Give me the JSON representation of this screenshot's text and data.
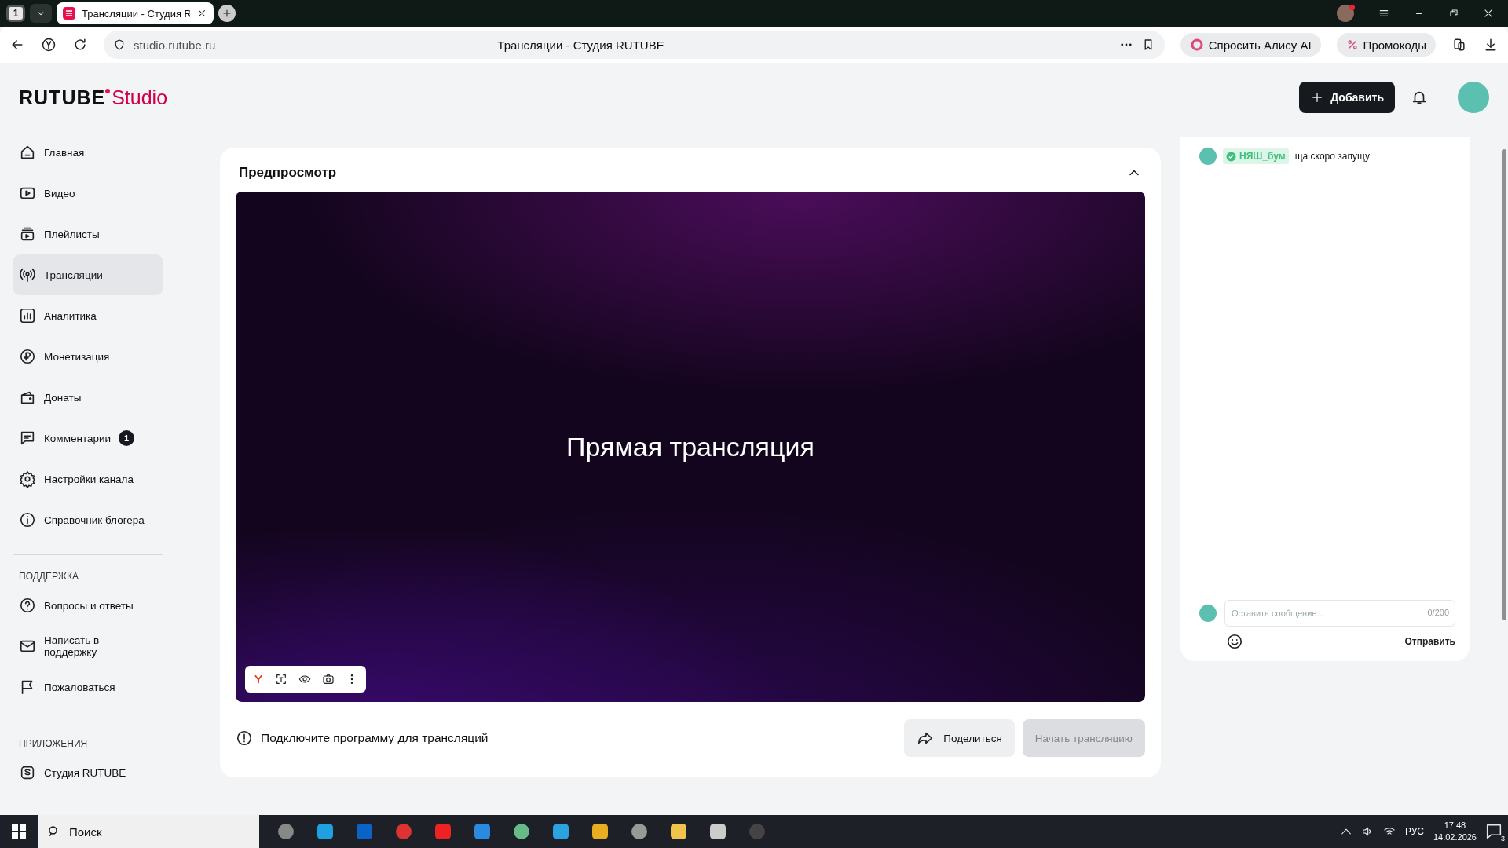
{
  "browser": {
    "tab_count": "1",
    "tabs": [
      {
        "title": "Трансляции - Студия R",
        "selected": true
      }
    ],
    "url": "studio.rutube.ru",
    "page_title": "Трансляции - Студия RUTUBE",
    "buttons": [
      "Спросить Алису AI",
      "Промокоды"
    ]
  },
  "header": {
    "logo": "RUTUBE",
    "logo_suffix": "Studio",
    "add_button": "Добавить"
  },
  "sidebar": {
    "items": [
      {
        "label": "Главная",
        "selected": false
      },
      {
        "label": "Видео",
        "selected": false
      },
      {
        "label": "Плейлисты",
        "selected": false
      },
      {
        "label": "Трансляции",
        "selected": true
      },
      {
        "label": "Аналитика",
        "selected": false
      },
      {
        "label": "Монетизация",
        "selected": false
      },
      {
        "label": "Донаты",
        "selected": false
      },
      {
        "label": "Комментарии",
        "selected": false,
        "badge": "1"
      },
      {
        "label": "Настройки канала",
        "selected": false
      },
      {
        "label": "Справочник блогера",
        "selected": false
      }
    ],
    "sections": [
      {
        "title": "ПОДДЕРЖКА",
        "items": [
          {
            "label": "Вопросы и ответы",
            "selected": false
          },
          {
            "label": "Написать в поддержку",
            "selected": false
          },
          {
            "label": "Пожаловаться",
            "selected": false
          }
        ]
      },
      {
        "title": "ПРИЛОЖЕНИЯ",
        "items": [
          {
            "label": "Студия RUTUBE",
            "selected": false
          }
        ]
      }
    ]
  },
  "preview": {
    "title": "Предпросмотр",
    "expanded": true,
    "overlay_text": "Прямая трансляция",
    "notice": "Подключите программу для трансляций",
    "share_button": "Поделиться",
    "start_button": {
      "label": "Начать трансляцию",
      "disabled": true
    }
  },
  "chat": {
    "messages": [
      {
        "author": "НЯШ_бум",
        "verified": true,
        "text": "ща скоро запущу"
      }
    ],
    "input": {
      "placeholder": "Оставить сообщение...",
      "counter": "0/200"
    },
    "send_button": "Отправить"
  },
  "taskbar": {
    "search_placeholder": "Поиск",
    "language": "РУС",
    "time": "17:48",
    "date": "14.02.2026",
    "notifications": "3"
  }
}
